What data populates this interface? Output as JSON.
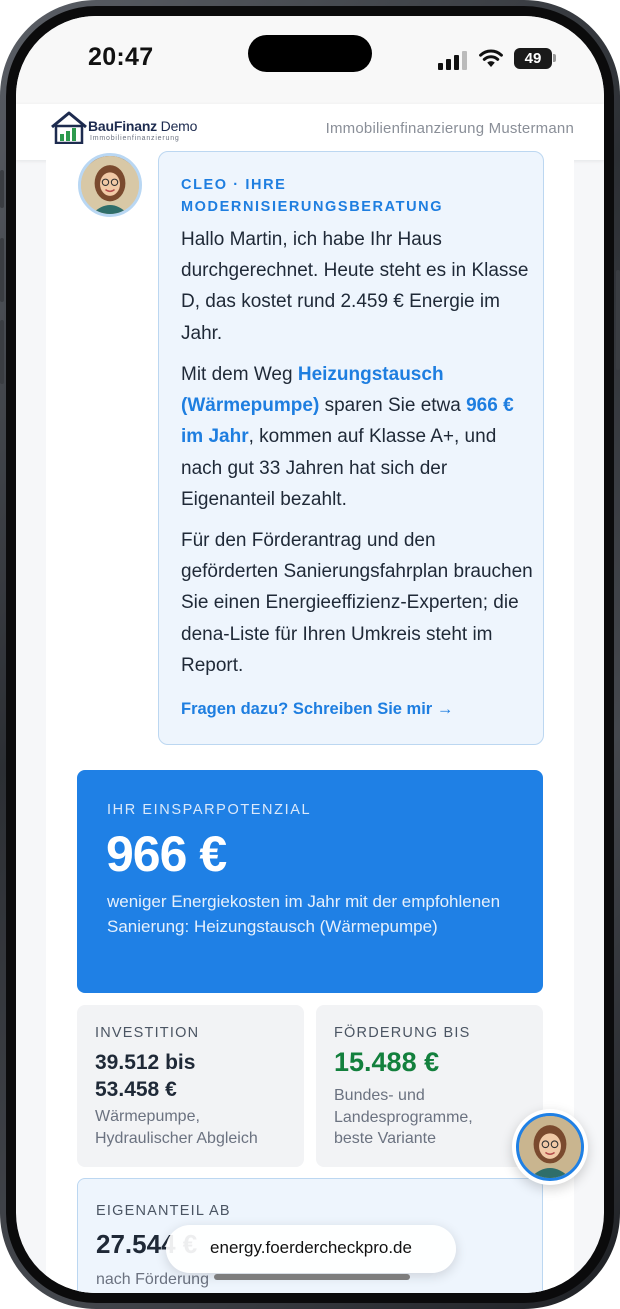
{
  "status_bar": {
    "time": "20:47",
    "battery": "49"
  },
  "header": {
    "logo_name_bold": "BauFinanz",
    "logo_name_light": " Demo",
    "logo_sub": "Immobilienfinanzierung",
    "right_text": "Immobilienfinanzierung Mustermann"
  },
  "chat": {
    "title": "CLEO · IHRE MODERNISIERUNGSBERATUNG",
    "para1": "Hallo Martin, ich habe Ihr Haus durchgerechnet. Heute steht es in Klasse D, das kostet rund 2.459 € Energie im Jahr.",
    "para2_pre": "Mit dem Weg ",
    "para2_hl1": "Heizungstausch (Wärmepumpe)",
    "para2_mid": " sparen Sie etwa ",
    "para2_hl2": "966 € im Jahr",
    "para2_post": ", kommen auf Klasse A+, und nach gut 33 Jahren hat sich der Eigenanteil bezahlt.",
    "para3": "Für den Förderantrag und den geförderten Sanierungsfahrplan brauchen Sie einen Energieeffizienz-Experten; die dena-Liste für Ihren Umkreis steht im Report.",
    "link": "Fragen dazu? Schreiben Sie mir →"
  },
  "savings": {
    "label": "IHR EINSPARPOTENZIAL",
    "value": "966 €",
    "description": "weniger Energiekosten im Jahr mit der empfohlenen Sanierung: Heizungstausch (Wärmepumpe)"
  },
  "investment": {
    "label": "INVESTITION",
    "value_line1": "39.512 bis",
    "value_line2": "53.458 €",
    "description": "Wärmepumpe, Hydraulischer Abgleich"
  },
  "funding": {
    "label": "FÖRDERUNG BIS",
    "value": "15.488 €",
    "description": "Bundes- und Landesprogramme, beste Variante"
  },
  "own_share": {
    "label": "EIGENANTEIL AB",
    "value": "27.544 €",
    "description": "nach Förderung"
  },
  "browser": {
    "url": "energy.foerdercheckpro.de"
  },
  "colors": {
    "accent": "#1f80e5",
    "green": "#13803d",
    "bubble_bg": "#eef5fd"
  }
}
